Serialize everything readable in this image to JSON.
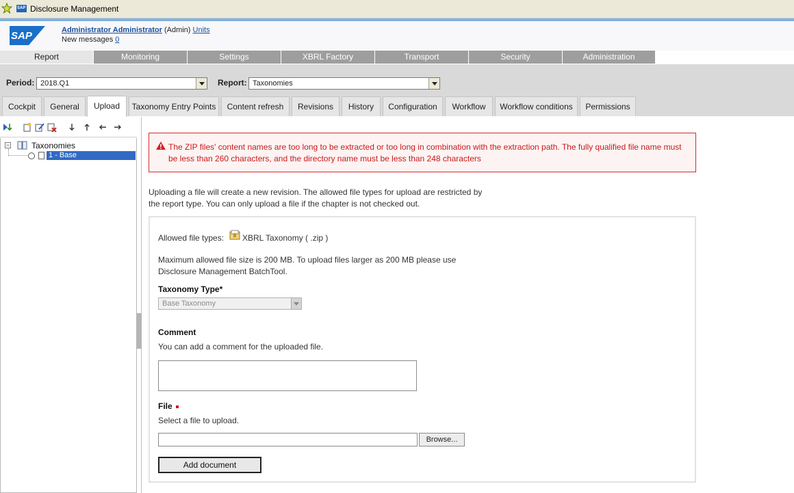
{
  "window": {
    "title": "Disclosure Management",
    "app_icon": "sap-mini-icon",
    "star_icon": "favorites-star-icon"
  },
  "header": {
    "logo": "SAP",
    "user_name": "Administrator Administrator",
    "role": "(Admin)",
    "units_link": "Units",
    "messages_label": "New messages",
    "messages_count": "0"
  },
  "main_nav": {
    "tabs": [
      {
        "label": "Report"
      },
      {
        "label": "Monitoring"
      },
      {
        "label": "Settings"
      },
      {
        "label": "XBRL Factory"
      },
      {
        "label": "Transport"
      },
      {
        "label": "Security"
      },
      {
        "label": "Administration"
      }
    ]
  },
  "filters": {
    "period_label": "Period:",
    "period_value": "2018.Q1",
    "report_label": "Report:",
    "report_value": "Taxonomies"
  },
  "sub_tabs": [
    {
      "label": "Cockpit"
    },
    {
      "label": "General"
    },
    {
      "label": "Upload"
    },
    {
      "label": "Taxonomy Entry Points"
    },
    {
      "label": "Content refresh"
    },
    {
      "label": "Revisions"
    },
    {
      "label": "History"
    },
    {
      "label": "Configuration"
    },
    {
      "label": "Workflow"
    },
    {
      "label": "Workflow conditions"
    },
    {
      "label": "Permissions"
    }
  ],
  "tree": {
    "root_label": "Taxonomies",
    "selected_item": "1 - Base"
  },
  "error": {
    "message": "The ZIP files' content names are too long to be extracted or too long in combination with the extraction path. The fully qualified file name must be less than 260 characters, and the directory name must be less than 248 characters"
  },
  "intro": {
    "line1": "Uploading a file will create a new revision. The allowed file types for upload are restricted by",
    "line2": "the report type. You can only upload a file if the chapter is not checked out."
  },
  "form": {
    "allowed_label": "Allowed file types:",
    "allowed_type": "XBRL Taxonomy ( .zip )",
    "max_size_line1": "Maximum allowed file size is 200 MB. To upload files larger as 200 MB please use",
    "max_size_line2": "Disclosure Management BatchTool.",
    "taxonomy_type_label": "Taxonomy Type*",
    "taxonomy_type_value": "Base Taxonomy",
    "comment_label": "Comment",
    "comment_hint": "You can add a comment for the uploaded file.",
    "file_label": "File",
    "file_hint": "Select a file to upload.",
    "browse_label": "Browse...",
    "add_label": "Add document"
  },
  "colors": {
    "accent_blue": "#316ac5",
    "error_red": "#c81a1a",
    "nav_gray": "#9e9e9e"
  }
}
